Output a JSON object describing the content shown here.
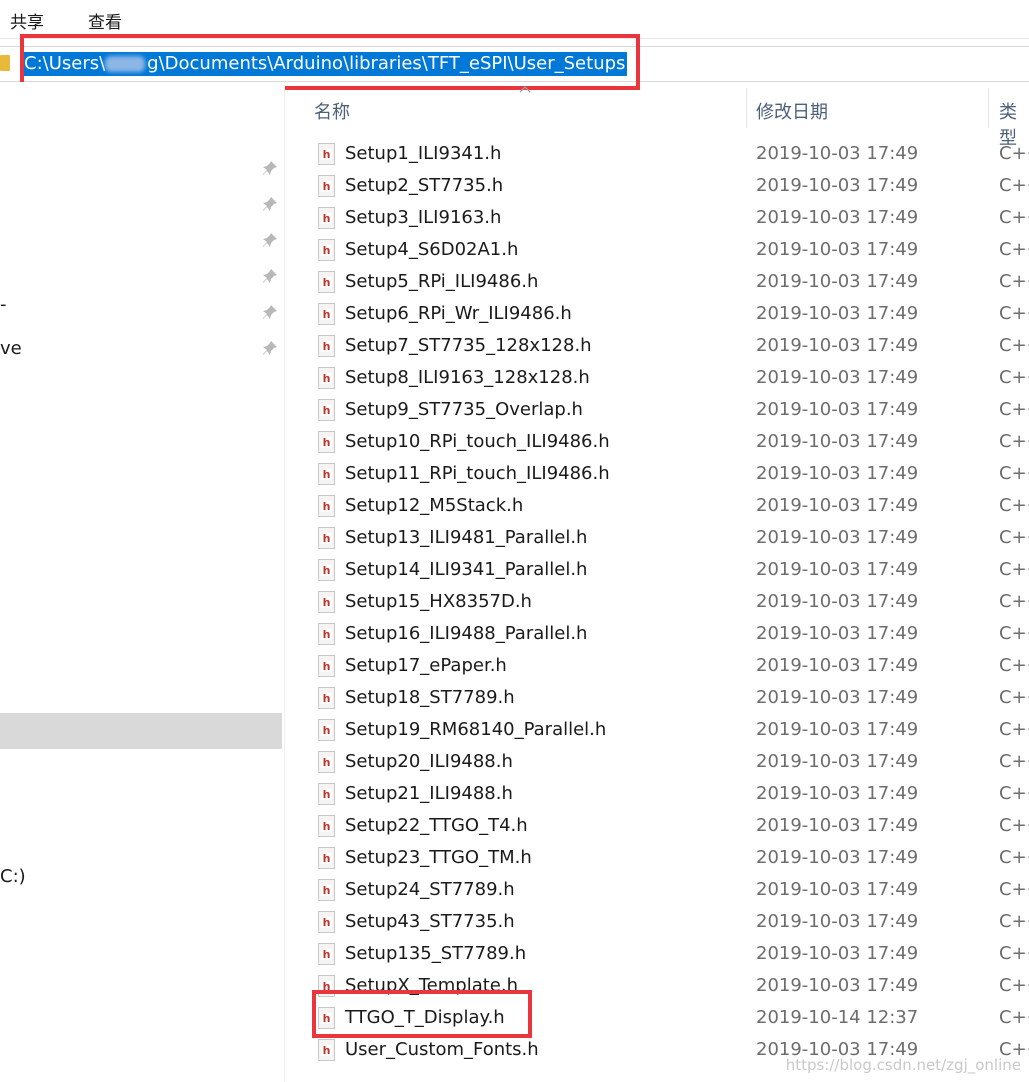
{
  "ribbon": {
    "tabs": [
      "共享",
      "查看"
    ]
  },
  "address_bar": {
    "path_start": "C:\\Users\\",
    "path_end": "g\\Documents\\Arduino\\libraries\\TFT_eSPI\\User_Setups"
  },
  "navigation": {
    "fragment_1": "-",
    "fragment_2": "ve",
    "fragment_3": "C:)"
  },
  "columns": {
    "name": "名称",
    "modified": "修改日期",
    "type": "类型"
  },
  "files": [
    {
      "name": "Setup1_ILI9341.h",
      "modified": "2019-10-03 17:49",
      "type": "C++"
    },
    {
      "name": "Setup2_ST7735.h",
      "modified": "2019-10-03 17:49",
      "type": "C++"
    },
    {
      "name": "Setup3_ILI9163.h",
      "modified": "2019-10-03 17:49",
      "type": "C++"
    },
    {
      "name": "Setup4_S6D02A1.h",
      "modified": "2019-10-03 17:49",
      "type": "C++"
    },
    {
      "name": "Setup5_RPi_ILI9486.h",
      "modified": "2019-10-03 17:49",
      "type": "C++"
    },
    {
      "name": "Setup6_RPi_Wr_ILI9486.h",
      "modified": "2019-10-03 17:49",
      "type": "C++"
    },
    {
      "name": "Setup7_ST7735_128x128.h",
      "modified": "2019-10-03 17:49",
      "type": "C++"
    },
    {
      "name": "Setup8_ILI9163_128x128.h",
      "modified": "2019-10-03 17:49",
      "type": "C++"
    },
    {
      "name": "Setup9_ST7735_Overlap.h",
      "modified": "2019-10-03 17:49",
      "type": "C++"
    },
    {
      "name": "Setup10_RPi_touch_ILI9486.h",
      "modified": "2019-10-03 17:49",
      "type": "C++"
    },
    {
      "name": "Setup11_RPi_touch_ILI9486.h",
      "modified": "2019-10-03 17:49",
      "type": "C++"
    },
    {
      "name": "Setup12_M5Stack.h",
      "modified": "2019-10-03 17:49",
      "type": "C++"
    },
    {
      "name": "Setup13_ILI9481_Parallel.h",
      "modified": "2019-10-03 17:49",
      "type": "C++"
    },
    {
      "name": "Setup14_ILI9341_Parallel.h",
      "modified": "2019-10-03 17:49",
      "type": "C++"
    },
    {
      "name": "Setup15_HX8357D.h",
      "modified": "2019-10-03 17:49",
      "type": "C++"
    },
    {
      "name": "Setup16_ILI9488_Parallel.h",
      "modified": "2019-10-03 17:49",
      "type": "C++"
    },
    {
      "name": "Setup17_ePaper.h",
      "modified": "2019-10-03 17:49",
      "type": "C++"
    },
    {
      "name": "Setup18_ST7789.h",
      "modified": "2019-10-03 17:49",
      "type": "C++"
    },
    {
      "name": "Setup19_RM68140_Parallel.h",
      "modified": "2019-10-03 17:49",
      "type": "C++"
    },
    {
      "name": "Setup20_ILI9488.h",
      "modified": "2019-10-03 17:49",
      "type": "C++"
    },
    {
      "name": "Setup21_ILI9488.h",
      "modified": "2019-10-03 17:49",
      "type": "C++"
    },
    {
      "name": "Setup22_TTGO_T4.h",
      "modified": "2019-10-03 17:49",
      "type": "C++"
    },
    {
      "name": "Setup23_TTGO_TM.h",
      "modified": "2019-10-03 17:49",
      "type": "C++"
    },
    {
      "name": "Setup24_ST7789.h",
      "modified": "2019-10-03 17:49",
      "type": "C++"
    },
    {
      "name": "Setup43_ST7735.h",
      "modified": "2019-10-03 17:49",
      "type": "C++"
    },
    {
      "name": "Setup135_ST7789.h",
      "modified": "2019-10-03 17:49",
      "type": "C++"
    },
    {
      "name": "SetupX_Template.h",
      "modified": "2019-10-03 17:49",
      "type": "C++"
    },
    {
      "name": "TTGO_T_Display.h",
      "modified": "2019-10-14 12:37",
      "type": "C++"
    },
    {
      "name": "User_Custom_Fonts.h",
      "modified": "2019-10-03 17:49",
      "type": "C++"
    }
  ],
  "watermark": "https://blog.csdn.net/zgj_online",
  "colors": {
    "selection": "#0078d7",
    "highlight_box": "#e8363c",
    "file_icon_letter": "#c0352b"
  }
}
